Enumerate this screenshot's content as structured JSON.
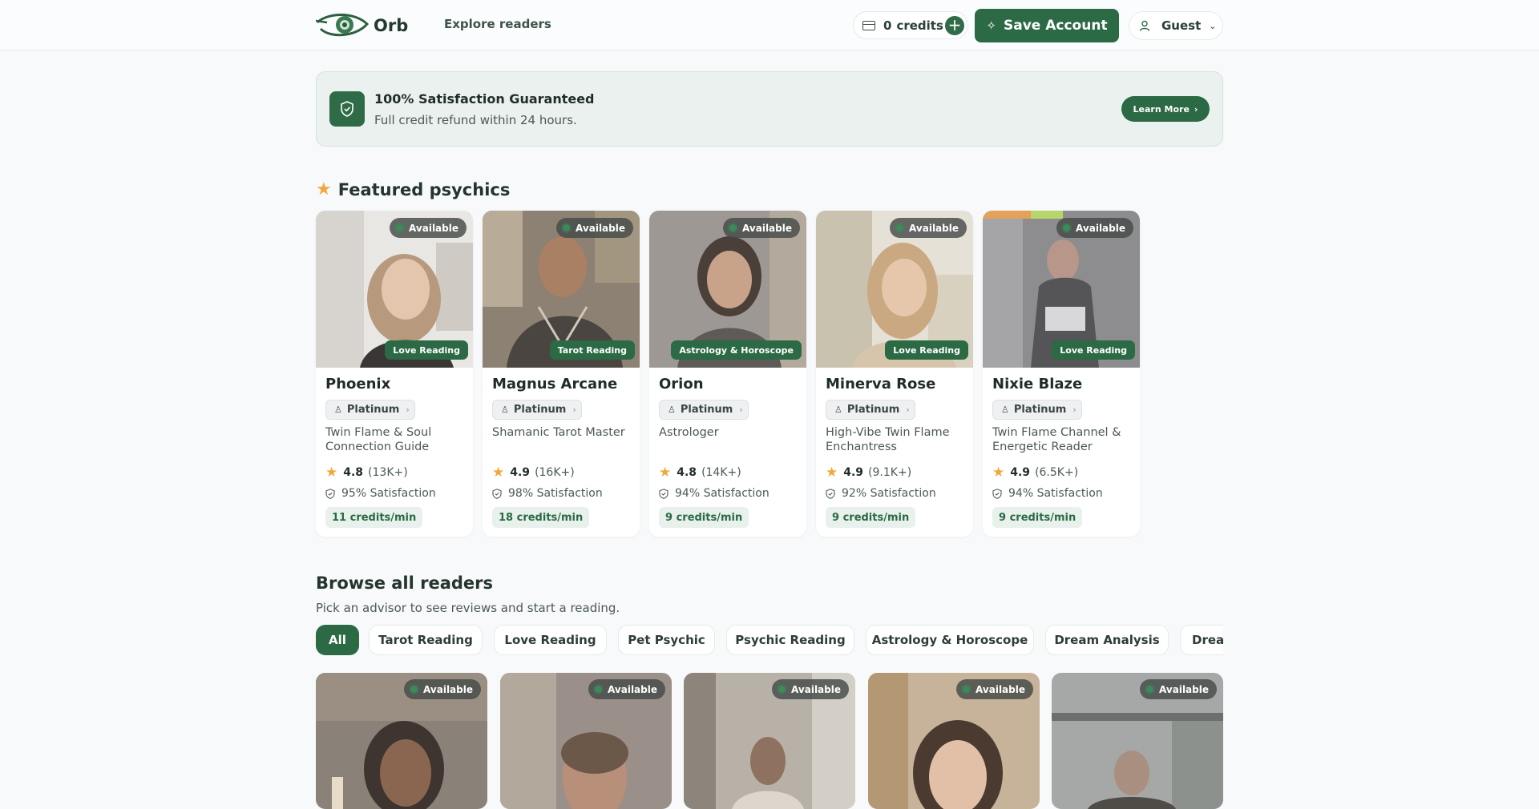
{
  "nav": {
    "brand": "Orb",
    "explore": "Explore readers",
    "credits_count": "0",
    "credits_label": "credits",
    "save_account": "Save Account",
    "user": "Guest"
  },
  "banner": {
    "title": "100% Satisfaction Guaranteed",
    "subtitle": "Full credit refund within 24 hours.",
    "cta": "Learn More"
  },
  "featured": {
    "title": "Featured psychics",
    "cards": [
      {
        "name": "Phoenix",
        "status": "Available",
        "category": "Love Reading",
        "tier": "Platinum",
        "desc": "Twin Flame & Soul Connection Guide",
        "rating": "4.8",
        "reviews": "(13K+)",
        "satisfaction": "95% Satisfaction",
        "rate": "11 credits/min"
      },
      {
        "name": "Magnus Arcane",
        "status": "Available",
        "category": "Tarot Reading",
        "tier": "Platinum",
        "desc": "Shamanic Tarot Master",
        "rating": "4.9",
        "reviews": "(16K+)",
        "satisfaction": "98% Satisfaction",
        "rate": "18 credits/min"
      },
      {
        "name": "Orion",
        "status": "Available",
        "category": "Astrology & Horoscope",
        "tier": "Platinum",
        "desc": "Astrologer",
        "rating": "4.8",
        "reviews": "(14K+)",
        "satisfaction": "94% Satisfaction",
        "rate": "9 credits/min"
      },
      {
        "name": "Minerva Rose",
        "status": "Available",
        "category": "Love Reading",
        "tier": "Platinum",
        "desc": "High-Vibe Twin Flame Enchantress",
        "rating": "4.9",
        "reviews": "(9.1K+)",
        "satisfaction": "92% Satisfaction",
        "rate": "9 credits/min"
      },
      {
        "name": "Nixie Blaze",
        "status": "Available",
        "category": "Love Reading",
        "tier": "Platinum",
        "desc": "Twin Flame Channel & Energetic Reader",
        "rating": "4.9",
        "reviews": "(6.5K+)",
        "satisfaction": "94% Satisfaction",
        "rate": "9 credits/min"
      }
    ]
  },
  "browse": {
    "title": "Browse all readers",
    "subtitle": "Pick an advisor to see reviews and start a reading.",
    "filters": [
      "All",
      "Tarot Reading",
      "Love Reading",
      "Pet Psychic",
      "Psychic Reading",
      "Astrology & Horoscope",
      "Dream Analysis",
      "Dream"
    ],
    "cards": [
      {
        "status": "Available"
      },
      {
        "status": "Available"
      },
      {
        "status": "Available"
      },
      {
        "status": "Available"
      },
      {
        "status": "Available"
      }
    ]
  },
  "colors": {
    "accent": "#2b6a44",
    "star": "#f2a73a",
    "background": "#f7f9fb"
  }
}
